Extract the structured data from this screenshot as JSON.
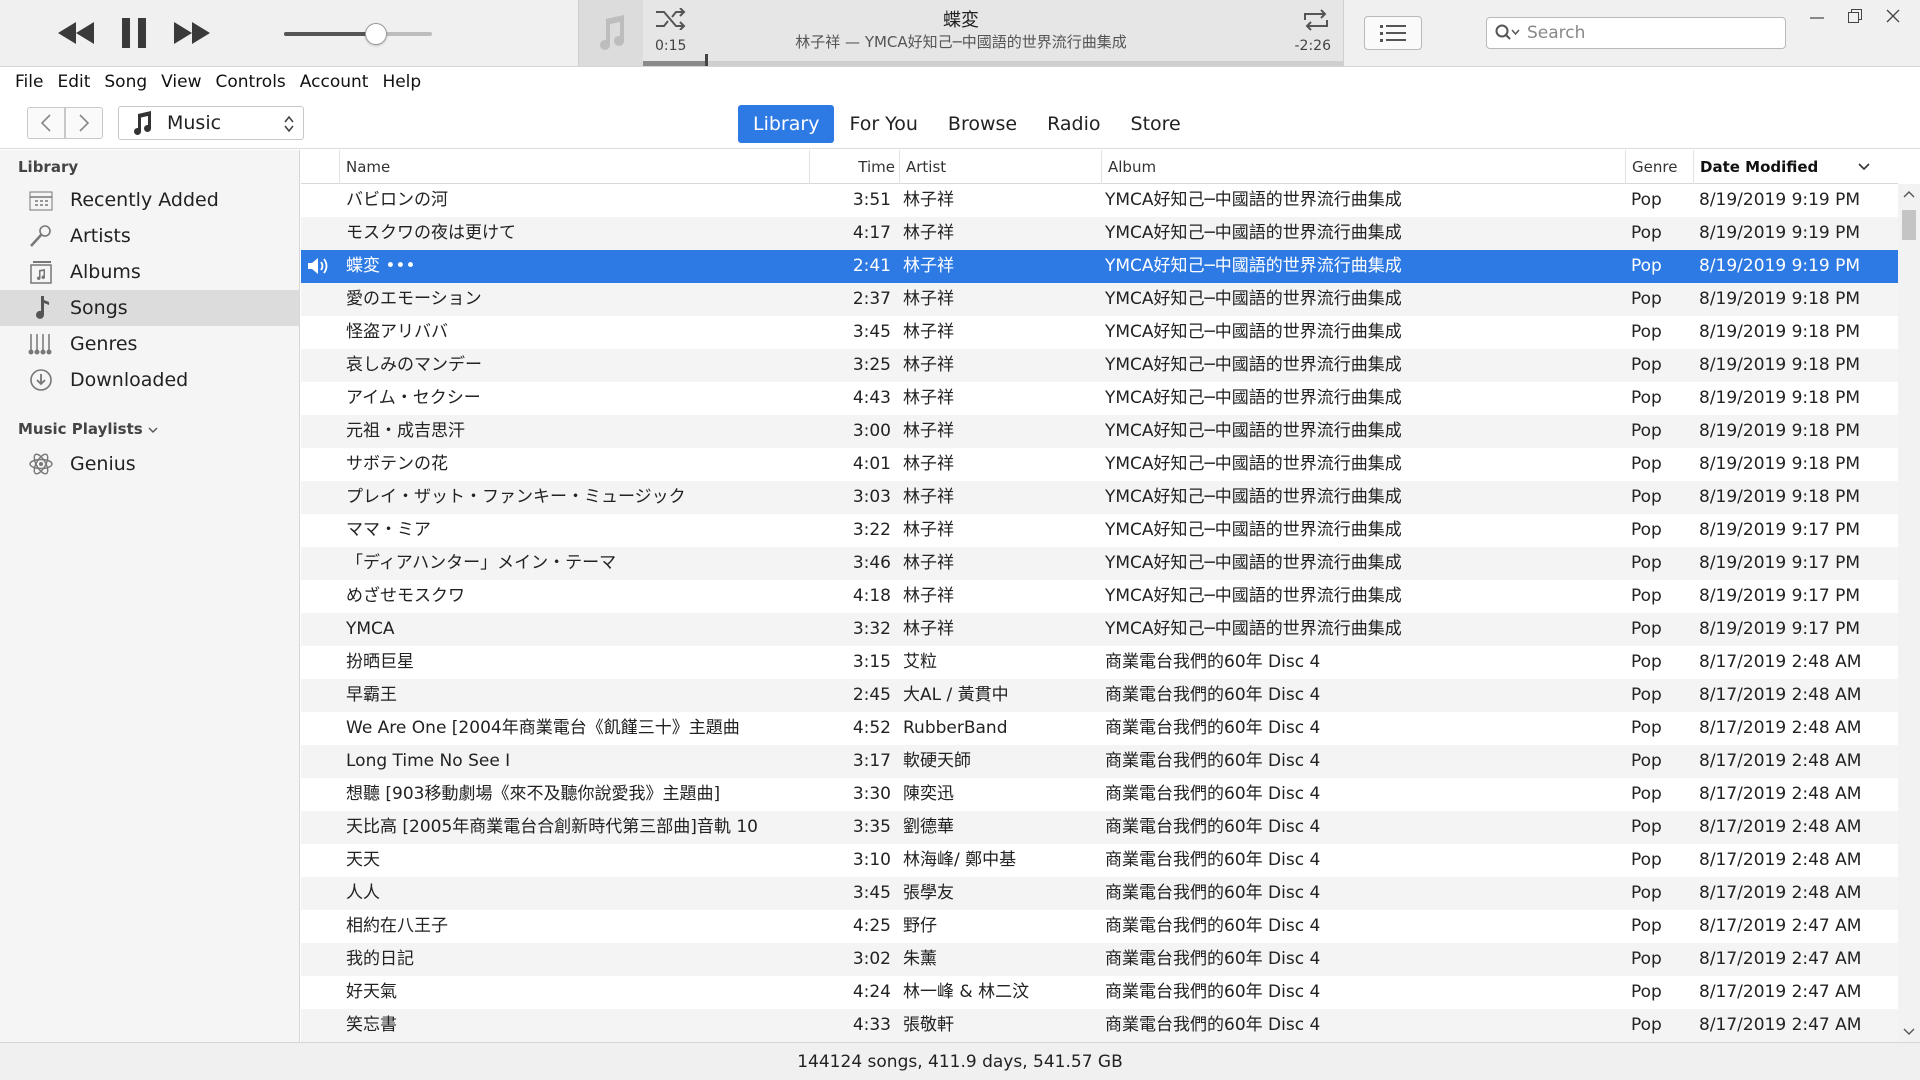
{
  "player": {
    "now_title": "蝶変",
    "now_subtitle": "林子祥 — YMCA好知己─中國語的世界流行曲集成",
    "elapsed": "0:15",
    "remaining": "-2:26",
    "progress": 0.09,
    "volume": 0.62
  },
  "search": {
    "placeholder": "Search"
  },
  "menu": [
    "File",
    "Edit",
    "Song",
    "View",
    "Controls",
    "Account",
    "Help"
  ],
  "media_picker": {
    "label": "Music"
  },
  "tabs": [
    {
      "label": "Library",
      "active": true
    },
    {
      "label": "For You",
      "active": false
    },
    {
      "label": "Browse",
      "active": false
    },
    {
      "label": "Radio",
      "active": false
    },
    {
      "label": "Store",
      "active": false
    }
  ],
  "sidebar": {
    "library_heading": "Library",
    "items": [
      {
        "label": "Recently Added",
        "icon": "recently-added-icon"
      },
      {
        "label": "Artists",
        "icon": "artists-icon"
      },
      {
        "label": "Albums",
        "icon": "albums-icon"
      },
      {
        "label": "Songs",
        "icon": "songs-icon",
        "active": true
      },
      {
        "label": "Genres",
        "icon": "genres-icon"
      },
      {
        "label": "Downloaded",
        "icon": "downloaded-icon"
      }
    ],
    "playlists_heading": "Music Playlists",
    "playlists": [
      {
        "label": "Genius",
        "icon": "genius-icon"
      }
    ]
  },
  "table": {
    "columns": {
      "name": "Name",
      "time": "Time",
      "artist": "Artist",
      "album": "Album",
      "genre": "Genre",
      "date": "Date Modified"
    },
    "rows": [
      {
        "name": "バビロンの河",
        "time": "3:51",
        "artist": "林子祥",
        "album": "YMCA好知己─中國語的世界流行曲集成",
        "genre": "Pop",
        "date": "8/19/2019 9:19 PM"
      },
      {
        "name": "モスクワの夜は更けて",
        "time": "4:17",
        "artist": "林子祥",
        "album": "YMCA好知己─中國語的世界流行曲集成",
        "genre": "Pop",
        "date": "8/19/2019 9:19 PM"
      },
      {
        "name": "蝶変 •••",
        "time": "2:41",
        "artist": "林子祥",
        "album": "YMCA好知己─中國語的世界流行曲集成",
        "genre": "Pop",
        "date": "8/19/2019 9:19 PM",
        "playing": true
      },
      {
        "name": "愛のエモーション",
        "time": "2:37",
        "artist": "林子祥",
        "album": "YMCA好知己─中國語的世界流行曲集成",
        "genre": "Pop",
        "date": "8/19/2019 9:18 PM"
      },
      {
        "name": "怪盗アリババ",
        "time": "3:45",
        "artist": "林子祥",
        "album": "YMCA好知己─中國語的世界流行曲集成",
        "genre": "Pop",
        "date": "8/19/2019 9:18 PM"
      },
      {
        "name": "哀しみのマンデー",
        "time": "3:25",
        "artist": "林子祥",
        "album": "YMCA好知己─中國語的世界流行曲集成",
        "genre": "Pop",
        "date": "8/19/2019 9:18 PM"
      },
      {
        "name": "アイム・セクシー",
        "time": "4:43",
        "artist": "林子祥",
        "album": "YMCA好知己─中國語的世界流行曲集成",
        "genre": "Pop",
        "date": "8/19/2019 9:18 PM"
      },
      {
        "name": "元祖・成吉思汗",
        "time": "3:00",
        "artist": "林子祥",
        "album": "YMCA好知己─中國語的世界流行曲集成",
        "genre": "Pop",
        "date": "8/19/2019 9:18 PM"
      },
      {
        "name": "サボテンの花",
        "time": "4:01",
        "artist": "林子祥",
        "album": "YMCA好知己─中國語的世界流行曲集成",
        "genre": "Pop",
        "date": "8/19/2019 9:18 PM"
      },
      {
        "name": "プレイ・ザット・ファンキー・ミュージック",
        "time": "3:03",
        "artist": "林子祥",
        "album": "YMCA好知己─中國語的世界流行曲集成",
        "genre": "Pop",
        "date": "8/19/2019 9:18 PM"
      },
      {
        "name": "ママ・ミア",
        "time": "3:22",
        "artist": "林子祥",
        "album": "YMCA好知己─中國語的世界流行曲集成",
        "genre": "Pop",
        "date": "8/19/2019 9:17 PM"
      },
      {
        "name": "「ディアハンター」メイン・テーマ",
        "time": "3:46",
        "artist": "林子祥",
        "album": "YMCA好知己─中國語的世界流行曲集成",
        "genre": "Pop",
        "date": "8/19/2019 9:17 PM"
      },
      {
        "name": "めざせモスクワ",
        "time": "4:18",
        "artist": "林子祥",
        "album": "YMCA好知己─中國語的世界流行曲集成",
        "genre": "Pop",
        "date": "8/19/2019 9:17 PM"
      },
      {
        "name": "YMCA",
        "time": "3:32",
        "artist": "林子祥",
        "album": "YMCA好知己─中國語的世界流行曲集成",
        "genre": "Pop",
        "date": "8/19/2019 9:17 PM"
      },
      {
        "name": "扮晒巨星",
        "time": "3:15",
        "artist": "艾粒",
        "album": "商業電台我們的60年 Disc 4",
        "genre": "Pop",
        "date": "8/17/2019 2:48 AM"
      },
      {
        "name": "早霸王",
        "time": "2:45",
        "artist": "大AL / 黃貫中",
        "album": "商業電台我們的60年 Disc 4",
        "genre": "Pop",
        "date": "8/17/2019 2:48 AM"
      },
      {
        "name": "We Are One [2004年商業電台《飢饉三十》主題曲",
        "time": "4:52",
        "artist": "RubberBand",
        "album": "商業電台我們的60年 Disc 4",
        "genre": "Pop",
        "date": "8/17/2019 2:48 AM"
      },
      {
        "name": "Long Time No See I",
        "time": "3:17",
        "artist": "軟硬天師",
        "album": "商業電台我們的60年 Disc 4",
        "genre": "Pop",
        "date": "8/17/2019 2:48 AM"
      },
      {
        "name": "想聽 [903移動劇場《來不及聽你說愛我》主題曲]",
        "time": "3:30",
        "artist": "陳奕迅",
        "album": "商業電台我們的60年 Disc 4",
        "genre": "Pop",
        "date": "8/17/2019 2:48 AM"
      },
      {
        "name": "天比高 [2005年商業電台合創新時代第三部曲]音軌 10",
        "time": "3:35",
        "artist": "劉德華",
        "album": "商業電台我們的60年 Disc 4",
        "genre": "Pop",
        "date": "8/17/2019 2:48 AM"
      },
      {
        "name": "天天",
        "time": "3:10",
        "artist": "林海峰/ 鄭中基",
        "album": "商業電台我們的60年 Disc 4",
        "genre": "Pop",
        "date": "8/17/2019 2:48 AM"
      },
      {
        "name": "人人",
        "time": "3:45",
        "artist": "張學友",
        "album": "商業電台我們的60年 Disc 4",
        "genre": "Pop",
        "date": "8/17/2019 2:48 AM"
      },
      {
        "name": "相約在八王子",
        "time": "4:25",
        "artist": "野仔",
        "album": "商業電台我們的60年 Disc 4",
        "genre": "Pop",
        "date": "8/17/2019 2:47 AM"
      },
      {
        "name": "我的日記",
        "time": "3:02",
        "artist": "朱薰",
        "album": "商業電台我們的60年 Disc 4",
        "genre": "Pop",
        "date": "8/17/2019 2:47 AM"
      },
      {
        "name": "好天氣",
        "time": "4:24",
        "artist": "林一峰 & 林二汶",
        "album": "商業電台我們的60年 Disc 4",
        "genre": "Pop",
        "date": "8/17/2019 2:47 AM"
      },
      {
        "name": "笑忘書",
        "time": "4:33",
        "artist": "張敬軒",
        "album": "商業電台我們的60年 Disc 4",
        "genre": "Pop",
        "date": "8/17/2019 2:47 AM"
      }
    ]
  },
  "status": "144124 songs, 411.9 days, 541.57 GB",
  "colors": {
    "accent": "#2e7ae4",
    "sidebar_bg": "#f5f5f5",
    "row_alt": "#f4f4f4"
  }
}
